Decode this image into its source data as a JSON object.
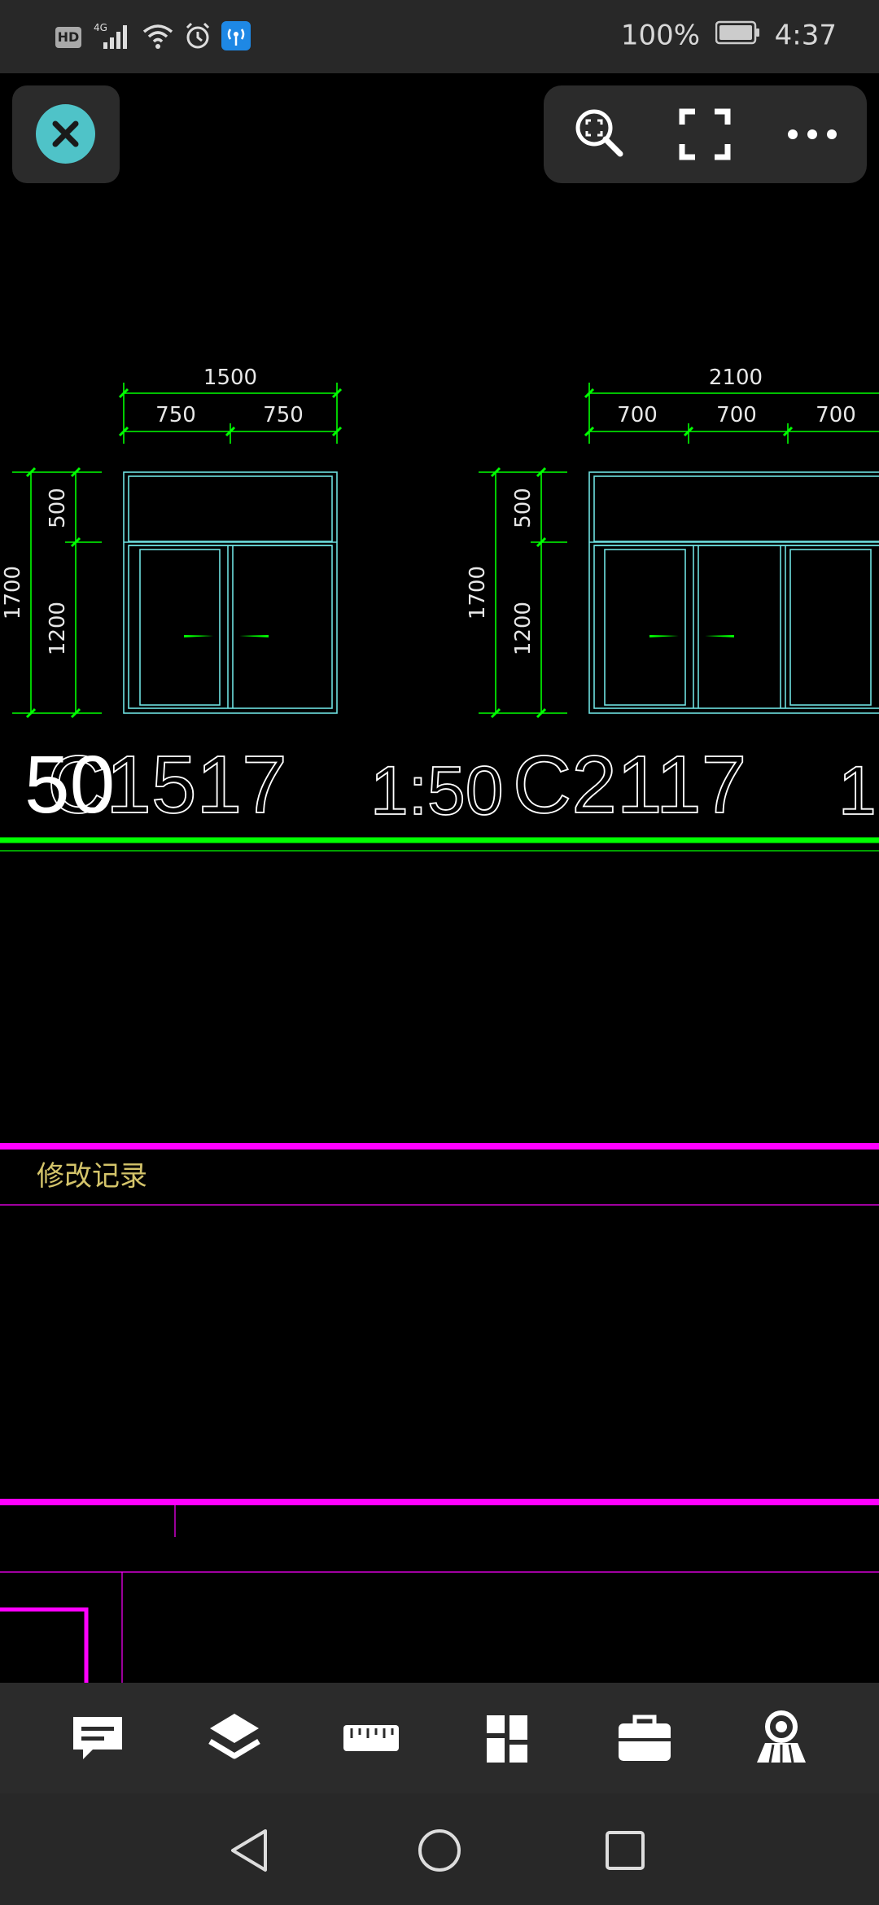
{
  "status_bar": {
    "hd_label": "HD",
    "network_label": "4G",
    "battery_percent": "100%",
    "time": "4:37"
  },
  "top_toolbar": {
    "close_icon": "close-icon",
    "zoom_extents_icon": "zoom-extents-icon",
    "fullscreen_icon": "fullscreen-icon",
    "more_icon": "more-icon"
  },
  "drawing": {
    "window1": {
      "total_width": "1500",
      "seg_widths": [
        "750",
        "750"
      ],
      "total_height": "1700",
      "seg_heights": [
        "500",
        "1200"
      ]
    },
    "window2": {
      "total_width": "2100",
      "seg_widths": [
        "700",
        "700",
        "700"
      ],
      "total_height": "1700",
      "seg_heights": [
        "500",
        "1200"
      ]
    },
    "big_labels": {
      "left_scale": "50",
      "w1_code": "C1517",
      "scale_mid": "1:50",
      "w2_code": "C2117",
      "right_scale": "1:"
    },
    "revision_label": "修改记录"
  },
  "bottom_toolbar": {
    "items": [
      "comment-icon",
      "layers-icon",
      "measure-ruler-icon",
      "layout-grid-icon",
      "toolbox-icon",
      "view-3d-icon"
    ]
  },
  "nav_bar": {
    "items": [
      "back-icon",
      "home-icon",
      "recents-icon"
    ]
  },
  "colors": {
    "cad_background": "#000000",
    "dimension_green": "#00ff00",
    "outline_cyan": "#6ee0e0",
    "magenta": "#ff00ff",
    "revision_text": "#d4c46a",
    "panel": "#2b2b2b",
    "close_accent": "#4fc3c8"
  }
}
